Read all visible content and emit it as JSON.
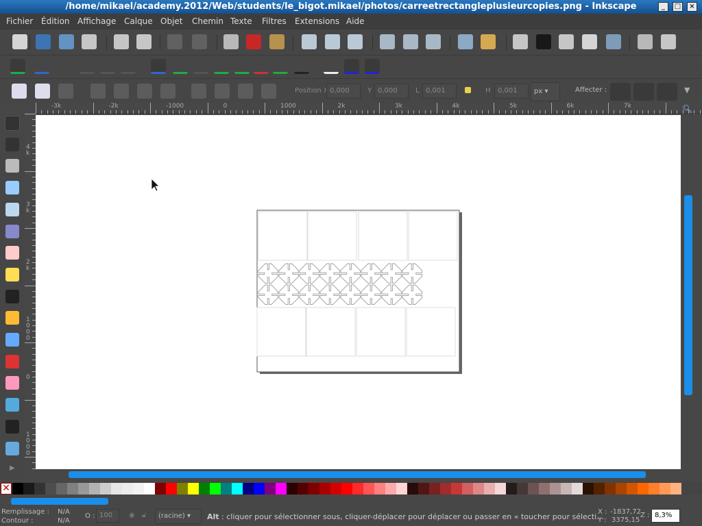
{
  "window": {
    "title": "/home/mikael/academy.2012/Web/students/le_bigot.mikael/photos/carreetrectangleplusieurcopies.png - Inkscape",
    "buttons": [
      "_",
      "□",
      "×"
    ]
  },
  "menu": [
    "Fichier",
    "Édition",
    "Affichage",
    "Calque",
    "Objet",
    "Chemin",
    "Texte",
    "Filtres",
    "Extensions",
    "Aide"
  ],
  "toolbar_commands": [
    "new-document-icon",
    "open-icon",
    "save-icon",
    "print-icon",
    "import-icon",
    "export-icon",
    "undo-icon",
    "redo-icon",
    "copy-icon",
    "cut-icon",
    "paste-icon",
    "zoom-selection-icon",
    "zoom-drawing-icon",
    "zoom-page-icon",
    "duplicate-icon",
    "clone-icon",
    "unlink-clone-icon",
    "group-icon",
    "ungroup-icon",
    "fill-stroke-icon",
    "text-font-icon",
    "layers-icon",
    "xml-editor-icon",
    "align-distribute-icon",
    "document-properties-icon",
    "preferences-icon"
  ],
  "toolbar_snap": [
    "snap-toggle-icon",
    "snap-bbox-icon",
    "snap-bbox-edge-icon",
    "snap-bbox-corner-icon",
    "snap-bbox-midpoint-icon",
    "snap-nodes-icon",
    "snap-path-icon",
    "snap-intersection-icon",
    "snap-cusp-node-icon",
    "snap-smooth-node-icon",
    "snap-line-midpoint-icon",
    "snap-object-center-icon",
    "snap-rotation-center-icon",
    "snap-page-border-icon",
    "snap-grid-icon",
    "snap-guide-icon"
  ],
  "toolbar_select": {
    "icons": [
      "select-all-icon",
      "select-all-layers-icon",
      "deselect-icon",
      "rotate-ccw-icon",
      "rotate-cw-icon",
      "flip-horizontal-icon",
      "flip-vertical-icon",
      "lower-bottom-icon",
      "lower-icon",
      "raise-icon",
      "raise-top-icon"
    ],
    "x_label": "Position X",
    "x_value": "0,000",
    "y_label": "Y",
    "y_value": "0,000",
    "w_label": "L",
    "w_value": "0,001",
    "h_label": "H",
    "h_value": "0,001",
    "unit": "px",
    "affect_label": "Affecter :"
  },
  "rulers": {
    "horizontal": [
      "-3k",
      "-2k",
      "-1000",
      "0",
      "1000",
      "2k",
      "3k",
      "4k",
      "5k",
      "6k",
      "7k"
    ],
    "vertical": [
      "4k",
      "3k",
      "2k",
      "1000",
      "0",
      "1000"
    ]
  },
  "tools": [
    "selector-tool-icon",
    "node-tool-icon",
    "tweak-tool-icon",
    "zoom-tool-icon",
    "rectangle-tool-icon",
    "3d-box-tool-icon",
    "ellipse-tool-icon",
    "star-tool-icon",
    "spiral-tool-icon",
    "pencil-tool-icon",
    "pen-tool-icon",
    "calligraphy-tool-icon",
    "eraser-tool-icon",
    "paint-bucket-tool-icon",
    "text-tool-icon",
    "connector-tool-icon"
  ],
  "palette": [
    "#000000",
    "#1a1a1a",
    "#333333",
    "#4d4d4d",
    "#666666",
    "#808080",
    "#999999",
    "#b3b3b3",
    "#cccccc",
    "#e6e6e6",
    "#ececec",
    "#f2f2f2",
    "#ffffff",
    "#800000",
    "#ff0000",
    "#808000",
    "#ffff00",
    "#008000",
    "#00ff00",
    "#008080",
    "#00ffff",
    "#000080",
    "#0000ff",
    "#800080",
    "#ff00ff",
    "#2b0000",
    "#550000",
    "#800000",
    "#aa0000",
    "#d40000",
    "#ff0000",
    "#ff2a2a",
    "#ff5555",
    "#ff8080",
    "#ffaaaa",
    "#ffd5d5",
    "#280b0b",
    "#501616",
    "#782121",
    "#a02c2c",
    "#c83737",
    "#d35f5f",
    "#de8787",
    "#e9afaf",
    "#f4d7d7",
    "#241c1c",
    "#483737",
    "#6c5353",
    "#916f6f",
    "#ac9393",
    "#c8b7b7",
    "#e3dbdb",
    "#2b1100",
    "#552200",
    "#803300",
    "#aa4400",
    "#d45500",
    "#ff6600",
    "#ff7f2a",
    "#ff9955",
    "#ffb380"
  ],
  "status": {
    "fill_label": "Remplissage :",
    "fill_value": "N/A",
    "stroke_label": "Contour :",
    "stroke_value": "N/A",
    "opacity_label": "O :",
    "opacity_value": "100",
    "layer": "(racine)",
    "message_key": "Alt",
    "message": " : cliquer pour sélectionner sous, cliquer-déplacer pour déplacer ou passer en « toucher pour sélecti...",
    "x_label": "X :",
    "x_value": "-1837,72",
    "y_label": "Y :",
    "y_value": "3375,15",
    "zoom_label": "Z :",
    "zoom_value": "8,3%"
  },
  "colors": {
    "accent": "#1a8ee8",
    "titlebar": "#1e64a8"
  }
}
